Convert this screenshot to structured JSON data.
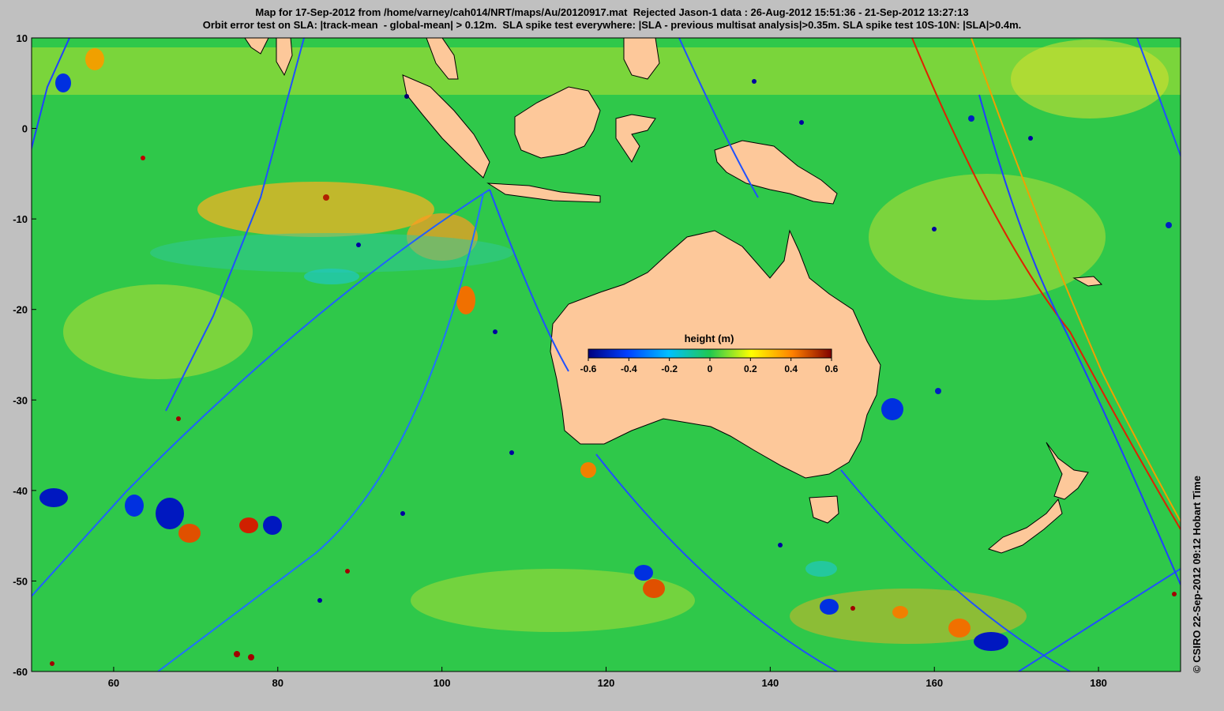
{
  "title": {
    "line1": "Map for 17-Sep-2012 from /home/varney/cah014/NRT/maps/Au/20120917.mat  Rejected Jason-1 data : 26-Aug-2012 15:51:36 - 21-Sep-2012 13:27:13",
    "line2": "Orbit error test on SLA: |track-mean  - global-mean| > 0.12m.  SLA spike test everywhere: |SLA - previous multisat analysis|>0.35m. SLA spike test 10S-10N: |SLA|>0.4m."
  },
  "credit": "© CSIRO 22-Sep-2012 09:12 Hobart Time",
  "map": {
    "lon_range": [
      50,
      190
    ],
    "lat_range": [
      -60,
      10
    ],
    "x_ticks": [
      "60",
      "80",
      "100",
      "120",
      "140",
      "160",
      "180"
    ],
    "y_ticks": [
      "10",
      "0",
      "-10",
      "-20",
      "-30",
      "-40",
      "-50",
      "-60"
    ],
    "land_color": "#fdc89a",
    "ocean_base_color": "#2fc84a"
  },
  "colorbar": {
    "label": "height (m)",
    "ticks": [
      "-0.6",
      "-0.4",
      "-0.2",
      "0",
      "0.2",
      "0.4",
      "0.6"
    ],
    "range": [
      -0.6,
      0.6
    ],
    "colors": [
      "#00007f",
      "#0040ff",
      "#00c0ff",
      "#20c850",
      "#ffff00",
      "#ff8000",
      "#800000"
    ]
  }
}
